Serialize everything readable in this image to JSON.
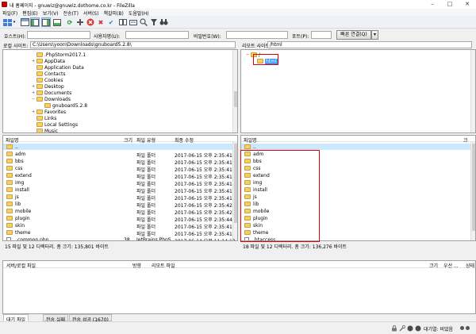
{
  "window": {
    "title": "내 홈페이지 - gnuwiz@gnuwiz.dothome.co.kr - FileZilla"
  },
  "menu": [
    "파일(F)",
    "편집(E)",
    "보기(V)",
    "전송(T)",
    "서버(S)",
    "책갈피(B)",
    "도움말(H)"
  ],
  "quickconnect": {
    "host_label": "호스트(H):",
    "user_label": "사용자명(U):",
    "pass_label": "비밀번호(W):",
    "port_label": "포트(P):",
    "connect_label": "빠른 연결(Q)"
  },
  "local": {
    "site_label": "로컬 사이트:",
    "path": "C:\\Users\\yoon\\Downloads\\gnuboard5.2.8\\",
    "tree": [
      {
        "label": ".PhpStorm2017.1",
        "level": 0,
        "expander": ""
      },
      {
        "label": "AppData",
        "level": 0,
        "expander": "+"
      },
      {
        "label": "Application Data",
        "level": 0,
        "expander": ""
      },
      {
        "label": "Contacts",
        "level": 0,
        "expander": ""
      },
      {
        "label": "Cookies",
        "level": 0,
        "expander": ""
      },
      {
        "label": "Desktop",
        "level": 0,
        "expander": "+"
      },
      {
        "label": "Documents",
        "level": 0,
        "expander": "+"
      },
      {
        "label": "Downloads",
        "level": 0,
        "expander": "−"
      },
      {
        "label": "gnuboard5.2.8",
        "level": 1,
        "expander": ""
      },
      {
        "label": "Favorites",
        "level": 0,
        "expander": "+"
      },
      {
        "label": "Links",
        "level": 0,
        "expander": ""
      },
      {
        "label": "Local Settings",
        "level": 0,
        "expander": ""
      },
      {
        "label": "Music",
        "level": 0,
        "expander": ""
      }
    ],
    "columns": {
      "name": "파일명",
      "size": "크기",
      "type": "파일 유형",
      "modified": "최종 수정"
    },
    "files": [
      {
        "name": "..",
        "size": "",
        "type": "",
        "modified": ""
      },
      {
        "name": "adm",
        "size": "",
        "type": "파일 폴더",
        "modified": "2017-06-15 오후 2:35:41"
      },
      {
        "name": "bbs",
        "size": "",
        "type": "파일 폴더",
        "modified": "2017-06-15 오후 2:35:41"
      },
      {
        "name": "css",
        "size": "",
        "type": "파일 폴더",
        "modified": "2017-06-15 오후 2:35:41"
      },
      {
        "name": "extend",
        "size": "",
        "type": "파일 폴더",
        "modified": "2017-06-15 오후 2:35:41"
      },
      {
        "name": "img",
        "size": "",
        "type": "파일 폴더",
        "modified": "2017-06-15 오후 2:35:41"
      },
      {
        "name": "install",
        "size": "",
        "type": "파일 폴더",
        "modified": "2017-06-15 오후 2:35:41"
      },
      {
        "name": "js",
        "size": "",
        "type": "파일 폴더",
        "modified": "2017-06-15 오후 2:35:41"
      },
      {
        "name": "lib",
        "size": "",
        "type": "파일 폴더",
        "modified": "2017-06-15 오후 2:35:42"
      },
      {
        "name": "mobile",
        "size": "",
        "type": "파일 폴더",
        "modified": "2017-06-15 오후 2:35:42"
      },
      {
        "name": "plugin",
        "size": "",
        "type": "파일 폴더",
        "modified": "2017-06-15 오후 2:35:44"
      },
      {
        "name": "skin",
        "size": "",
        "type": "파일 폴더",
        "modified": "2017-06-15 오후 2:35:41"
      },
      {
        "name": "theme",
        "size": "",
        "type": "파일 폴더",
        "modified": "2017-06-15 오후 2:35:41"
      },
      {
        "name": "_common.php",
        "size": "38",
        "type": "JetBrains PhpS...",
        "modified": "2017-06-14 오전 11:14:12"
      }
    ],
    "summary": "15 파일 및 12 디렉터리. 총 크기: 135,801 바이트"
  },
  "remote": {
    "site_label": "리모트 사이트:",
    "path": "/html",
    "tree": [
      {
        "label": "/",
        "level": 0,
        "expander": "−"
      },
      {
        "label": "html",
        "level": 1,
        "expander": ""
      }
    ],
    "columns": {
      "name": "파일명",
      "size": "크"
    },
    "files": [
      {
        "name": ".."
      },
      {
        "name": "adm"
      },
      {
        "name": "bbs"
      },
      {
        "name": "css"
      },
      {
        "name": "extend"
      },
      {
        "name": "img"
      },
      {
        "name": "install"
      },
      {
        "name": "js"
      },
      {
        "name": "lib"
      },
      {
        "name": "mobile"
      },
      {
        "name": "plugin"
      },
      {
        "name": "skin"
      },
      {
        "name": "theme"
      },
      {
        "name": ".htaccess"
      }
    ],
    "summary": "18 파일 및 12 디렉터리. 총 크기: 136,276 바이트"
  },
  "queue": {
    "columns": {
      "server_file": "서버/로컬 파일",
      "direction": "방향",
      "remote_file": "리모트 파일",
      "size": "크기",
      "priority": "우선 ...",
      "status": "상태"
    }
  },
  "queue_tabs": [
    "대기 파일",
    "전송 실패",
    "전송 성공 (1670)"
  ],
  "status": {
    "queue_label": "대기열: 비었음"
  },
  "colors": {
    "highlight": "#e00000",
    "selection": "#cce8ff",
    "folder": "#f3d06a"
  }
}
